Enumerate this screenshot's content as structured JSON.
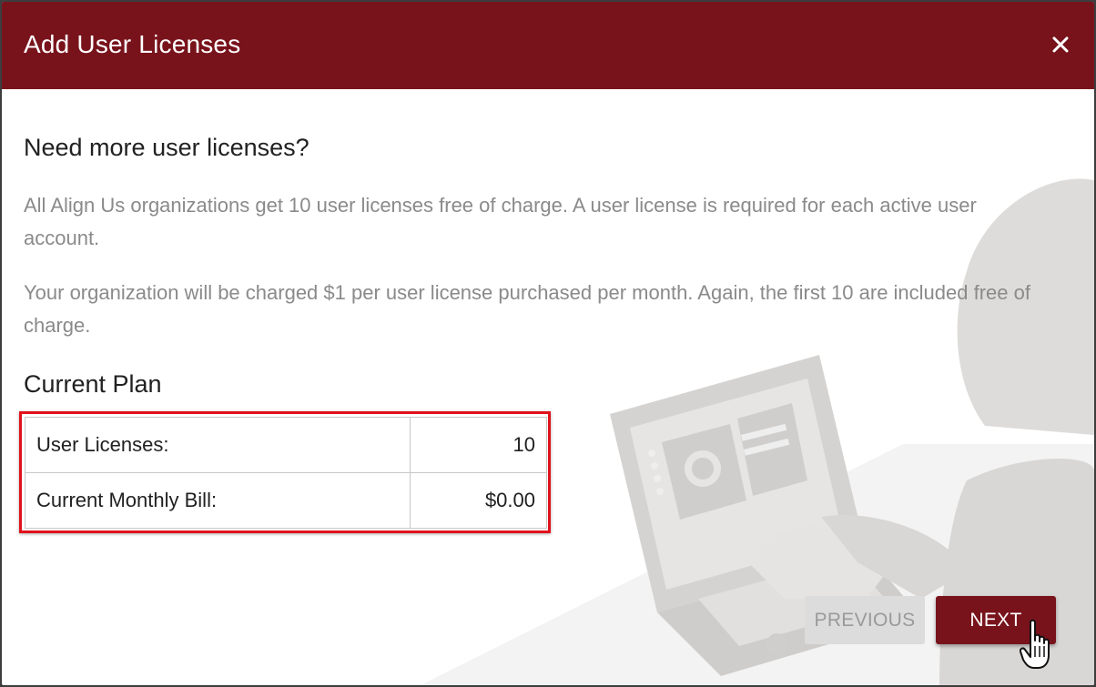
{
  "dialog": {
    "title": "Add User Licenses",
    "close_icon": "close-icon"
  },
  "content": {
    "heading": "Need more user licenses?",
    "paragraph1": "All Align Us organizations get 10 user licenses free of charge. A user license is required for each active user account.",
    "paragraph2": "Your organization will be charged $1 per user license purchased per month. Again, the first 10 are included free of charge."
  },
  "plan": {
    "heading": "Current Plan",
    "rows": [
      {
        "label": "User Licenses:",
        "value": "10"
      },
      {
        "label": "Current Monthly Bill:",
        "value": "$0.00"
      }
    ]
  },
  "footer": {
    "previous_label": "PREVIOUS",
    "next_label": "NEXT"
  },
  "colors": {
    "header_bg": "#78131c",
    "highlight_border": "#e0121c",
    "next_button_bg": "#78131c",
    "previous_button_bg": "#dcdcdc"
  }
}
